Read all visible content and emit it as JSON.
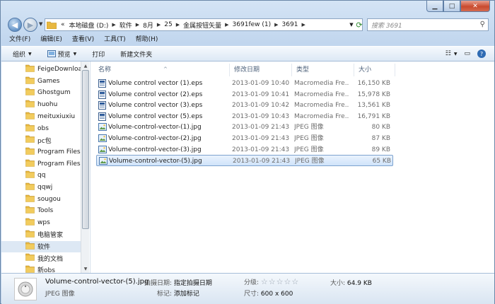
{
  "window": {
    "controls": {
      "minimize": "▁",
      "maximize": "□",
      "close": "✕"
    }
  },
  "address": {
    "overflow": "«",
    "crumbs": [
      "本地磁盘 (D:)",
      "软件",
      "8月",
      "25",
      "金属按钮矢量",
      "3691few (1)",
      "3691"
    ]
  },
  "search": {
    "placeholder": "搜索 3691"
  },
  "menu": [
    "文件(F)",
    "编辑(E)",
    "查看(V)",
    "工具(T)",
    "帮助(H)"
  ],
  "commands": {
    "organize": "组织",
    "preview": "预览",
    "print": "打印",
    "new_folder": "新建文件夹"
  },
  "nav_tree": [
    "FeigeDownloa",
    "Games",
    "Ghostgum",
    "huohu",
    "meituxiuxiu",
    "obs",
    "pc包",
    "Program Files",
    "Program Files",
    "qq",
    "qqwj",
    "sougou",
    "Tools",
    "wps",
    "电脑管家",
    "软件",
    "我的文档",
    "新obs"
  ],
  "columns": {
    "name": "名称",
    "date": "修改日期",
    "type": "类型",
    "size": "大小"
  },
  "files": [
    {
      "name": "Volume control vector (1).eps",
      "date": "2013-01-09 10:40",
      "type": "Macromedia Fre...",
      "size": "16,150 KB",
      "kind": "eps"
    },
    {
      "name": "Volume control vector (2).eps",
      "date": "2013-01-09 10:41",
      "type": "Macromedia Fre...",
      "size": "15,978 KB",
      "kind": "eps"
    },
    {
      "name": "Volume control vector (3).eps",
      "date": "2013-01-09 10:42",
      "type": "Macromedia Fre...",
      "size": "13,561 KB",
      "kind": "eps"
    },
    {
      "name": "Volume control vector (5).eps",
      "date": "2013-01-09 10:43",
      "type": "Macromedia Fre...",
      "size": "16,791 KB",
      "kind": "eps"
    },
    {
      "name": "Volume-control-vector-(1).jpg",
      "date": "2013-01-09 21:43",
      "type": "JPEG 图像",
      "size": "80 KB",
      "kind": "jpg"
    },
    {
      "name": "Volume-control-vector-(2).jpg",
      "date": "2013-01-09 21:43",
      "type": "JPEG 图像",
      "size": "87 KB",
      "kind": "jpg"
    },
    {
      "name": "Volume-control-vector-(3).jpg",
      "date": "2013-01-09 21:43",
      "type": "JPEG 图像",
      "size": "89 KB",
      "kind": "jpg"
    },
    {
      "name": "Volume-control-vector-(5).jpg",
      "date": "2013-01-09 21:43",
      "type": "JPEG 图像",
      "size": "65 KB",
      "kind": "jpg"
    }
  ],
  "selected_file_index": 7,
  "selected_tree_index": 15,
  "details": {
    "name": "Volume-control-vector-(5).jpg",
    "type": "JPEG 图像",
    "date_label": "拍摄日期:",
    "date_value": "指定拍摄日期",
    "tags_label": "标记:",
    "tags_value": "添加标记",
    "rating_label": "分级:",
    "rating_stars": "☆☆☆☆☆",
    "rating_value": 0,
    "size_label": "大小:",
    "size_value": "64.9 KB",
    "dim_label": "尺寸:",
    "dim_value": "600 x 600"
  },
  "colors": {
    "selection": "#cfe3fa",
    "folder": "#e8b840",
    "accent": "#3a74b4"
  }
}
